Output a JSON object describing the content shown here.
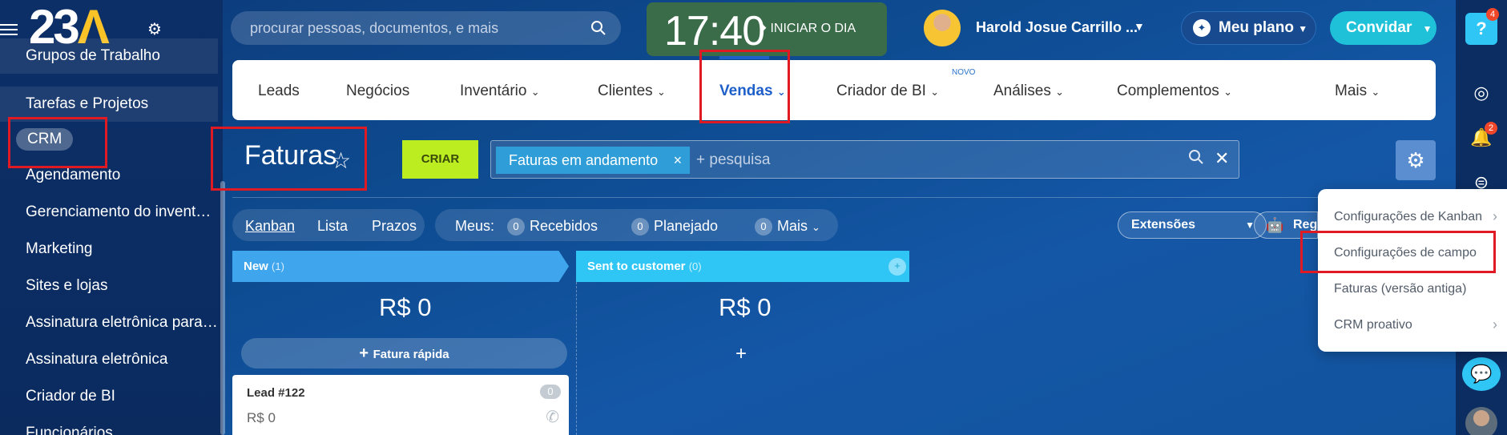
{
  "sidebar": {
    "logo": "23",
    "logo_mark": "Λ",
    "items": [
      {
        "label": "Grupos de Trabalho"
      },
      {
        "label": "Tarefas e Projetos"
      },
      {
        "label": "CRM"
      },
      {
        "label": "Agendamento"
      },
      {
        "label": "Gerenciamento do invent…"
      },
      {
        "label": "Marketing"
      },
      {
        "label": "Sites e lojas"
      },
      {
        "label": "Assinatura eletrônica para…"
      },
      {
        "label": "Assinatura eletrônica"
      },
      {
        "label": "Criador de BI"
      },
      {
        "label": "Funcionários"
      }
    ]
  },
  "header": {
    "search_placeholder": "procurar pessoas, documentos, e mais",
    "clock_time": "17:40",
    "start_day": "INICIAR O DIA",
    "user_name": "Harold Josue Carrillo ...",
    "plan_label": "Meu plano",
    "invite_label": "Convidar"
  },
  "rightbar": {
    "help": "?",
    "help_badge": "4",
    "bell_badge": "2"
  },
  "nav": {
    "items": [
      {
        "label": "Leads"
      },
      {
        "label": "Negócios"
      },
      {
        "label": "Inventário"
      },
      {
        "label": "Clientes"
      },
      {
        "label": "Vendas",
        "tag": "NOVO"
      },
      {
        "label": "Criador de BI"
      },
      {
        "label": "Análises"
      },
      {
        "label": "Complementos"
      },
      {
        "label": "Mais"
      }
    ]
  },
  "page": {
    "title": "Faturas",
    "create_label": "CRIAR",
    "filter_chip": "Faturas em andamento",
    "filter_placeholder": "+ pesquisa"
  },
  "views": {
    "tabs": [
      "Kanban",
      "Lista",
      "Prazos"
    ],
    "my_label": "Meus:",
    "counters": [
      {
        "count": "0",
        "label": "Recebidos"
      },
      {
        "count": "0",
        "label": "Planejado"
      },
      {
        "count": "0",
        "label": "Mais"
      }
    ],
    "extensions": "Extensões",
    "robots": "Regr"
  },
  "kanban": {
    "columns": [
      {
        "name": "New",
        "count": "(1)",
        "sum": "R$ 0"
      },
      {
        "name": "Sent to customer",
        "count": "(0)",
        "sum": "R$ 0"
      }
    ],
    "quick_invoice": "Fatura rápida",
    "cards": [
      {
        "title": "Lead #122",
        "price": "R$ 0",
        "count": "0"
      }
    ]
  },
  "settings_menu": {
    "items": [
      {
        "label": "Configurações de Kanban"
      },
      {
        "label": "Configurações de campo"
      },
      {
        "label": "Faturas (versão antiga)"
      },
      {
        "label": "CRM proativo"
      }
    ]
  },
  "colors": {
    "create": "#bbed21",
    "invite": "#1fc1d8",
    "highlight": "#e01a22",
    "column_new": "#3fa5ec",
    "column_sent": "#2fc6f6"
  }
}
